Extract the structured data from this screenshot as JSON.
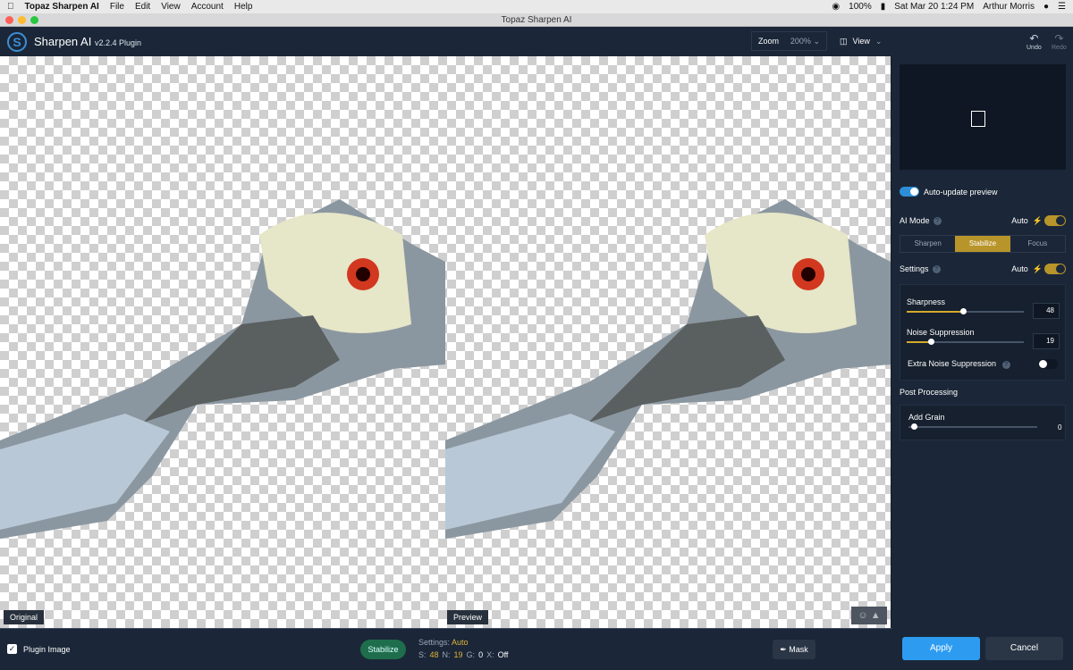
{
  "menubar": {
    "apple_icon": "apple-icon",
    "app_name": "Topaz Sharpen AI",
    "menus": [
      "File",
      "Edit",
      "View",
      "Account",
      "Help"
    ],
    "battery": "100%",
    "datetime": "Sat Mar 20  1:24 PM",
    "user": "Arthur Morris"
  },
  "window": {
    "title": "Topaz Sharpen AI"
  },
  "header": {
    "app_title": "Sharpen AI",
    "version": "v2.2.4 Plugin",
    "zoom_label": "Zoom",
    "zoom_value": "200%",
    "view_label": "View"
  },
  "panes": {
    "original_label": "Original",
    "preview_label": "Preview"
  },
  "bottom": {
    "plugin_image_label": "Plugin Image",
    "mode_button": "Stabilize",
    "settings_label": "Settings:",
    "settings_value": "Auto",
    "s_label": "S:",
    "s_value": "48",
    "n_label": "N:",
    "n_value": "19",
    "g_label": "G:",
    "g_value": "0",
    "x_label": "X:",
    "x_value": "Off",
    "mask_label": "Mask"
  },
  "sidebar": {
    "undo_label": "Undo",
    "redo_label": "Redo",
    "auto_update_label": "Auto-update preview",
    "ai_mode_label": "AI Mode",
    "ai_mode_auto": "Auto",
    "modes": [
      "Sharpen",
      "Stabilize",
      "Focus"
    ],
    "active_mode": "Stabilize",
    "settings_label": "Settings",
    "settings_auto": "Auto",
    "sharpness_label": "Sharpness",
    "sharpness_value": "48",
    "noise_label": "Noise Suppression",
    "noise_value": "19",
    "extra_noise_label": "Extra Noise Suppression",
    "post_processing_label": "Post Processing",
    "add_grain_label": "Add Grain",
    "add_grain_value": "0",
    "apply_label": "Apply",
    "cancel_label": "Cancel"
  },
  "colors": {
    "accent_blue": "#2d8fd8",
    "accent_gold": "#b8952a",
    "panel_bg": "#1b2738"
  }
}
